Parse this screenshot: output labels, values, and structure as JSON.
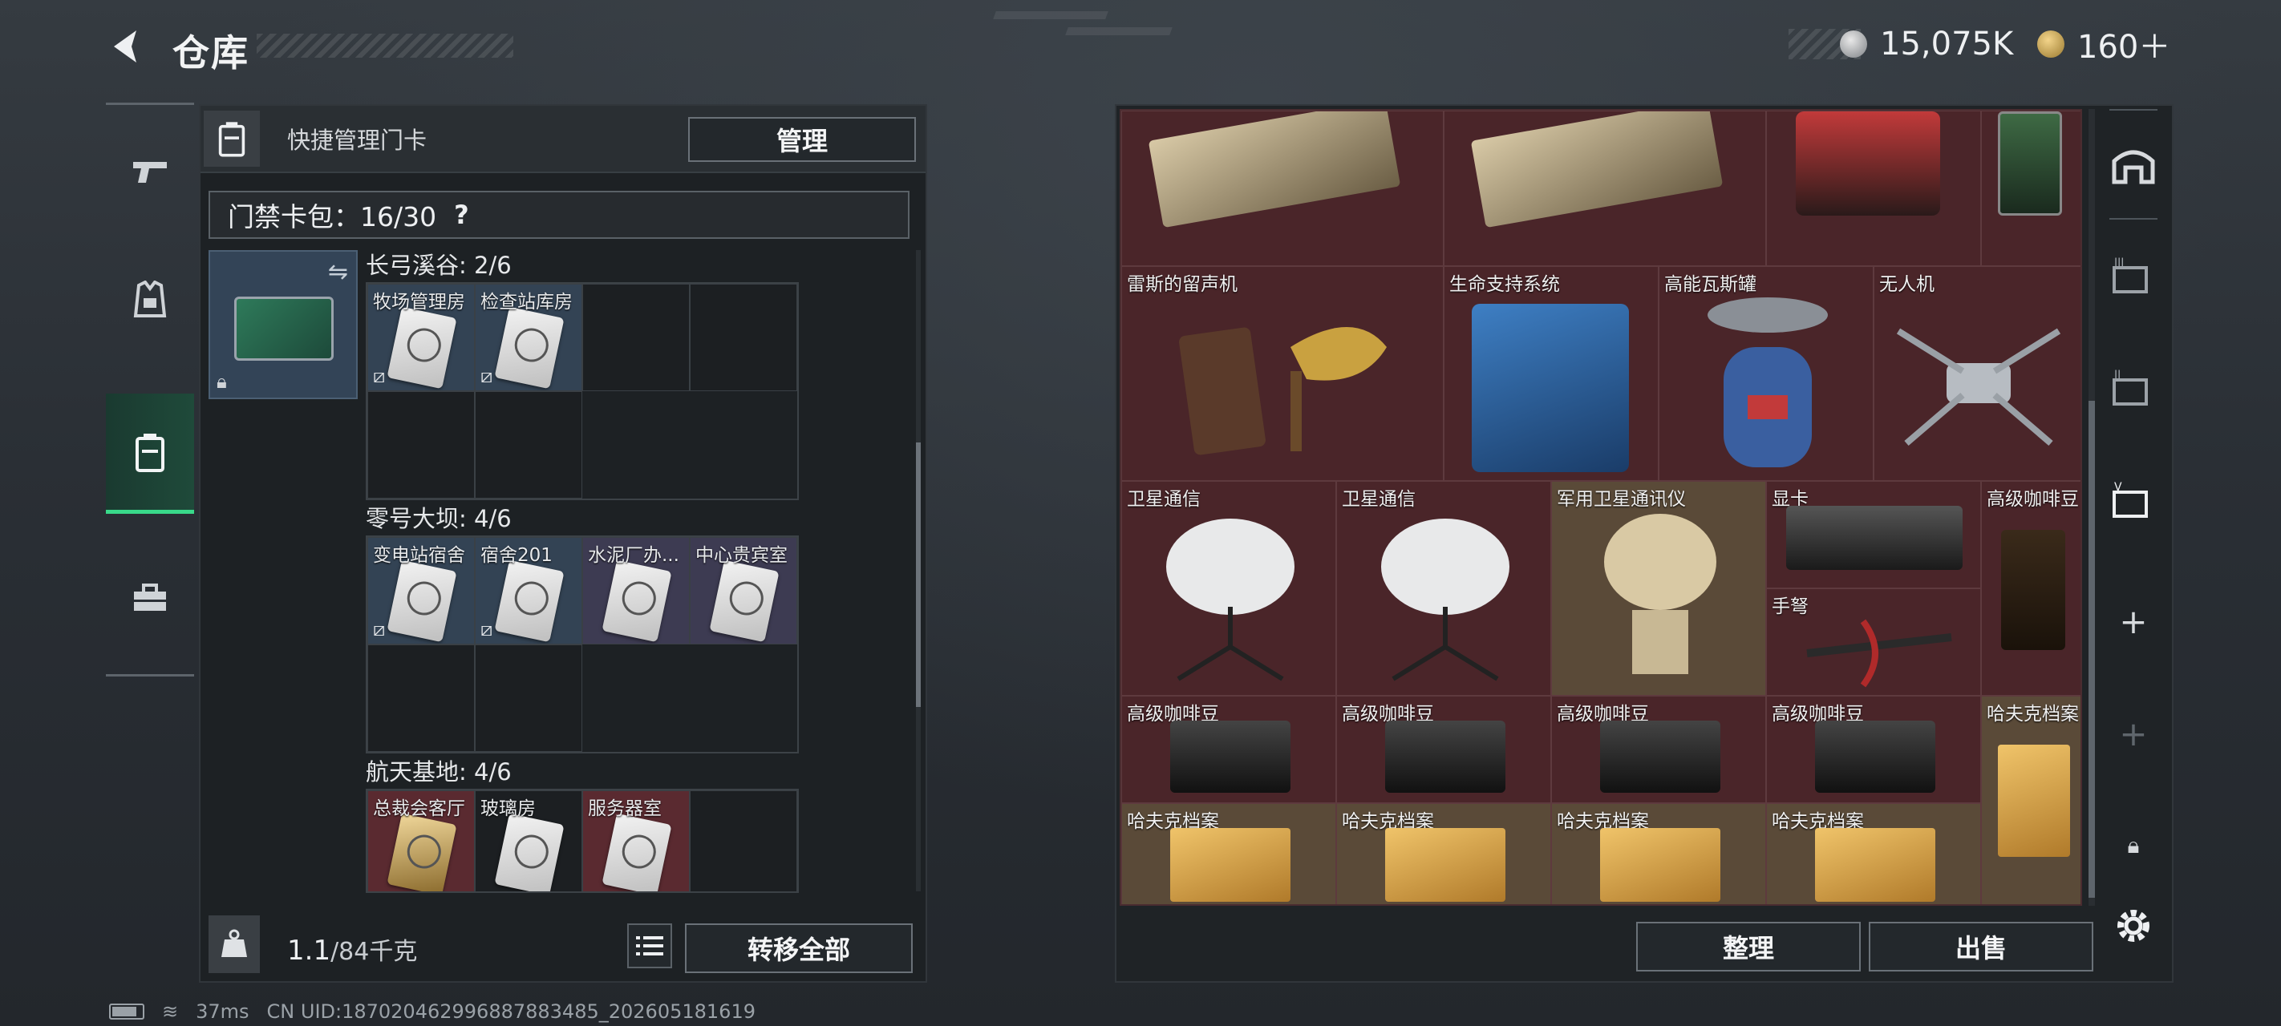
{
  "header": {
    "title": "仓库",
    "currency_silver": "15,075K",
    "currency_gold": "160＋"
  },
  "left_panel": {
    "header_label": "快捷管理门卡",
    "manage_button": "管理",
    "card_pack": "门禁卡包：16/30",
    "help": "?",
    "groups": [
      {
        "title": "长弓溪谷: 2/6",
        "cards": [
          "牧场管理房",
          "检查站库房"
        ]
      },
      {
        "title": "零号大坝: 4/6",
        "cards": [
          "变电站宿舍",
          "宿舍201",
          "水泥厂办...",
          "中心贵宾室"
        ]
      },
      {
        "title": "航天基地: 4/6",
        "cards": [
          "总裁会客厅",
          "玻璃房",
          "服务器室"
        ]
      }
    ],
    "weight_value": "1.1",
    "weight_unit": "/84千克",
    "transfer_button": "转移全部"
  },
  "items": [
    {
      "label": "雷斯的留声机"
    },
    {
      "label": "生命支持系统"
    },
    {
      "label": "高能瓦斯罐"
    },
    {
      "label": "无人机"
    },
    {
      "label": "卫星通信"
    },
    {
      "label": "卫星通信"
    },
    {
      "label": "军用卫星通讯仪"
    },
    {
      "label": "显卡"
    },
    {
      "label": "高级咖啡豆"
    },
    {
      "label": "手弩"
    },
    {
      "label": "高级咖啡豆"
    },
    {
      "label": "高级咖啡豆"
    },
    {
      "label": "高级咖啡豆"
    },
    {
      "label": "高级咖啡豆"
    },
    {
      "label": "哈夫克档案"
    },
    {
      "label": "哈夫克档案"
    },
    {
      "label": "哈夫克档案"
    },
    {
      "label": "哈夫克档案"
    },
    {
      "label": "哈夫克档案"
    }
  ],
  "buttons": {
    "sort": "整理",
    "sell": "出售"
  },
  "status": {
    "ping": "37ms",
    "uid": "CN UID:187020462996887883485_202605181619"
  },
  "colors": {
    "accent_green": "#39d98a",
    "item_bg_red": "#4a2529"
  }
}
